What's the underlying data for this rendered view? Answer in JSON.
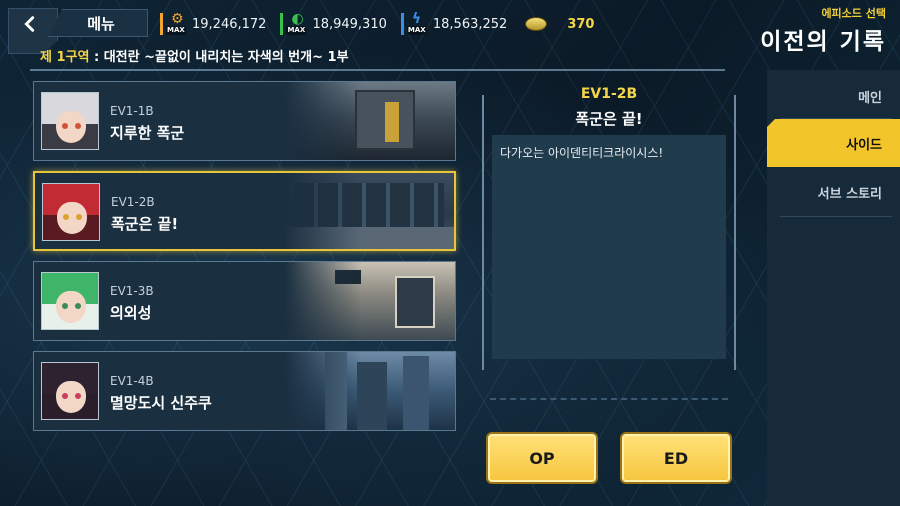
{
  "header": {
    "menu_label": "메뉴",
    "currencies": [
      {
        "icon": "gear-resource-icon",
        "color": "#f2a531",
        "max_label": "MAX",
        "value": "19,246,172"
      },
      {
        "icon": "green-resource-icon",
        "color": "#39c24a",
        "max_label": "MAX",
        "value": "18,949,310"
      },
      {
        "icon": "blue-resource-icon",
        "color": "#3a8ee6",
        "max_label": "MAX",
        "value": "18,563,252"
      }
    ],
    "coin": {
      "icon": "coin-icon",
      "value": "370"
    },
    "subtitle": "에피소드 선택",
    "title": "이전의 기록"
  },
  "stage": {
    "tag": "제 1구역",
    "text": " : 대전란 ~끝없이 내리치는 자색의 번개~ 1부"
  },
  "episodes": [
    {
      "code": "EV1-1B",
      "name": "지루한 폭군",
      "selected": false
    },
    {
      "code": "EV1-2B",
      "name": "폭군은 끝!",
      "selected": true
    },
    {
      "code": "EV1-3B",
      "name": "의외성",
      "selected": false
    },
    {
      "code": "EV1-4B",
      "name": "멸망도시 신주쿠",
      "selected": false
    }
  ],
  "detail": {
    "code": "EV1-2B",
    "name": "폭군은 끝!",
    "description": "다가오는 아이덴티티크라이시스!"
  },
  "buttons": {
    "op": "OP",
    "ed": "ED"
  },
  "side_tabs": [
    {
      "label": "메인",
      "active": false
    },
    {
      "label": "사이드",
      "active": true
    },
    {
      "label": "서브 스토리",
      "active": false
    }
  ],
  "colors": {
    "accent": "#f5d64a",
    "panel": "#1a2f40"
  }
}
